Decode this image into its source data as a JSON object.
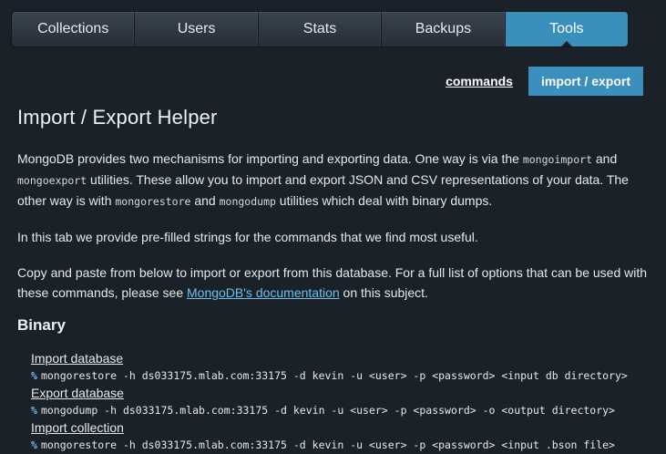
{
  "tabs": [
    {
      "label": "Collections"
    },
    {
      "label": "Users"
    },
    {
      "label": "Stats"
    },
    {
      "label": "Backups"
    },
    {
      "label": "Tools",
      "active": true
    }
  ],
  "subnav": {
    "commands_label": "commands",
    "import_export_label": "import / export"
  },
  "page": {
    "title": "Import / Export Helper",
    "intro": {
      "part1": "MongoDB provides two mechanisms for importing and exporting data. One way is via the ",
      "code1": "mongoimport",
      "part2": " and ",
      "code2": "mongoexport",
      "part3": " utilities. These allow you to import and export JSON and CSV representations of your data. The other way is with ",
      "code3": "mongorestore",
      "part4": " and ",
      "code4": "mongodump",
      "part5": " utilities which deal with binary dumps."
    },
    "tab_note": "In this tab we provide pre-filled strings for the commands that we find most useful.",
    "copy_note": {
      "before": "Copy and paste from below to import or export from this database. For a full list of options that can be used with these commands, please see ",
      "link": "MongoDB's documentation",
      "after": " on this subject."
    },
    "binary_heading": "Binary",
    "commands": [
      {
        "label": "Import database",
        "prompt": "%",
        "command": "mongorestore -h ds033175.mlab.com:33175 -d kevin -u <user> -p <password> <input db directory>"
      },
      {
        "label": "Export database",
        "prompt": "%",
        "command": "mongodump -h ds033175.mlab.com:33175 -d kevin -u <user> -p <password> -o <output directory>"
      },
      {
        "label": "Import collection",
        "prompt": "%",
        "command": "mongorestore -h ds033175.mlab.com:33175 -d kevin -u <user> -p <password> <input .bson file>"
      }
    ]
  },
  "colors": {
    "background": "#1a2128",
    "accent": "#3a8fbd",
    "link": "#6cc0ee"
  }
}
